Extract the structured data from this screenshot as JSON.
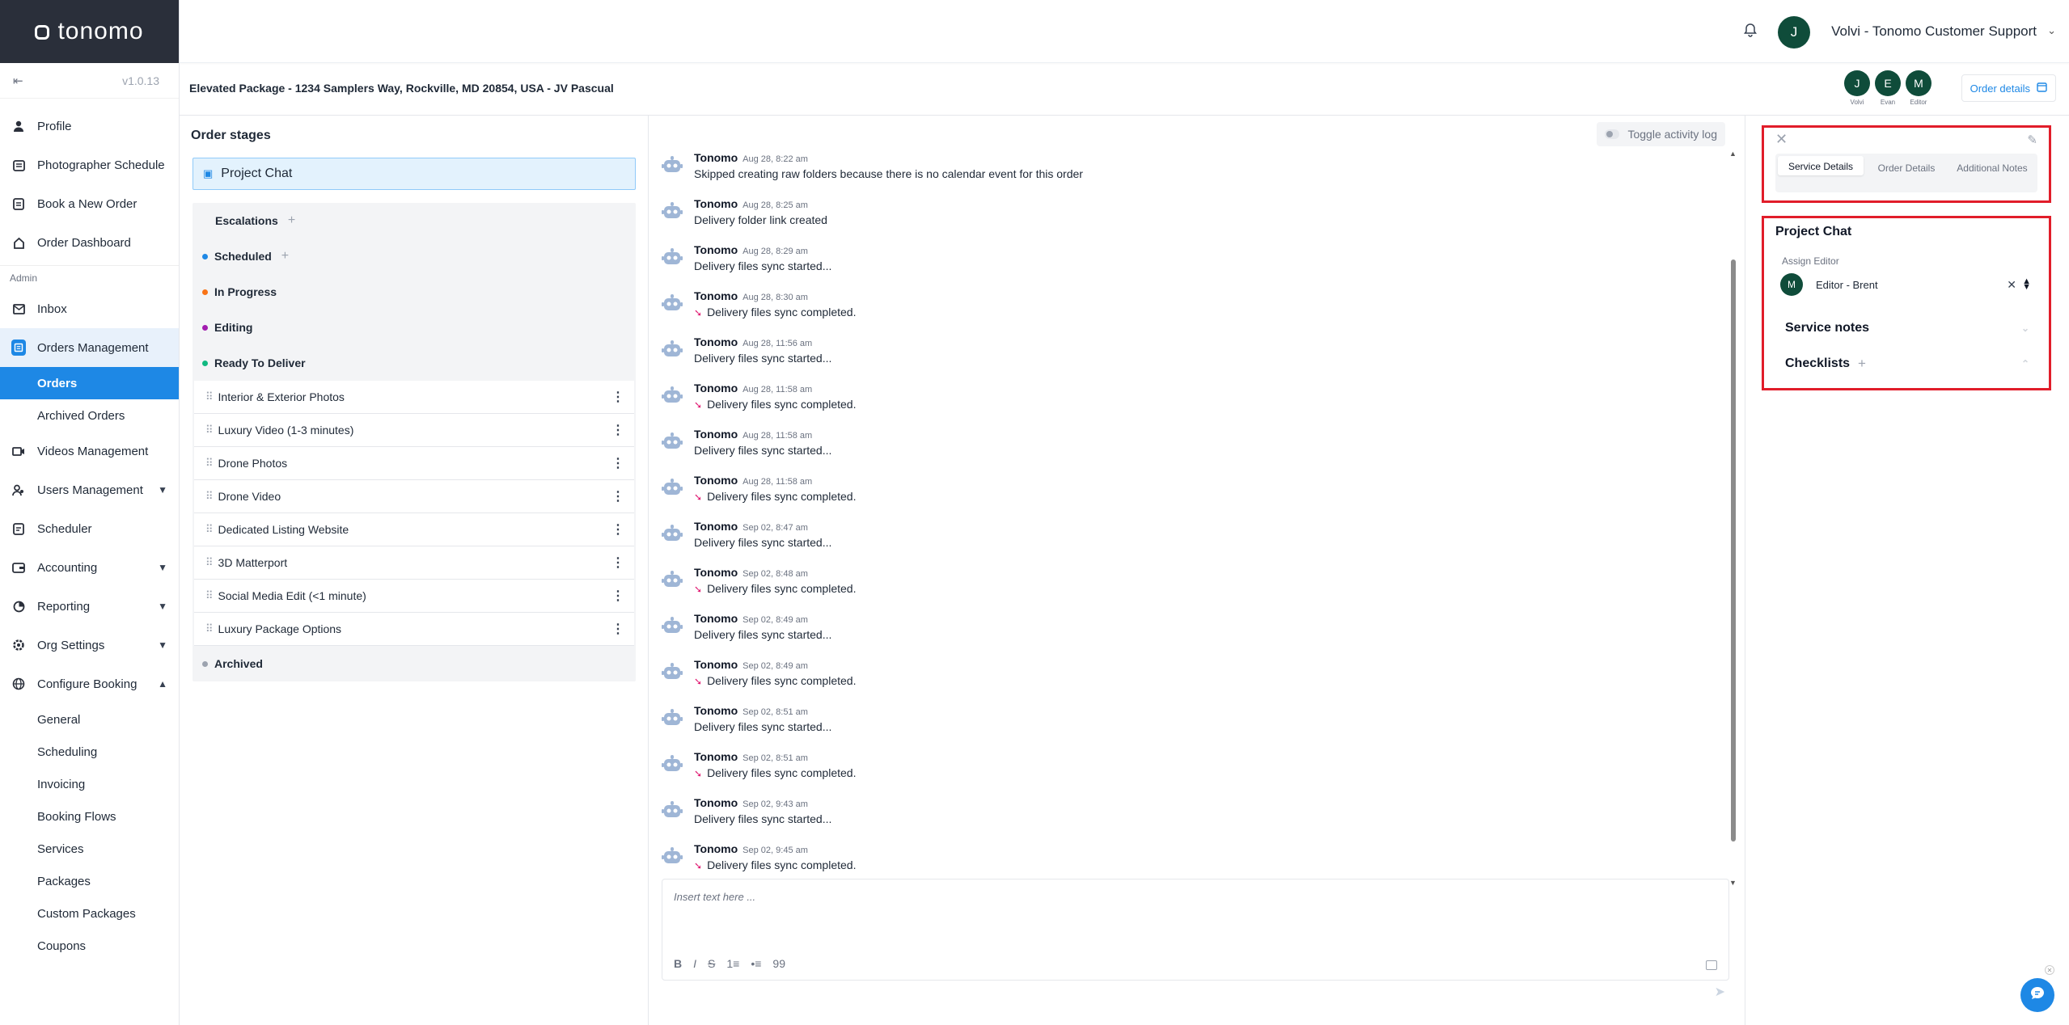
{
  "app": {
    "logo": "tonomo",
    "version": "v1.0.13"
  },
  "sidebar": {
    "items": [
      {
        "label": "Profile",
        "icon": "user-icon"
      },
      {
        "label": "Photographer Schedule",
        "icon": "calendar-icon"
      },
      {
        "label": "Book a New Order",
        "icon": "clipboard-icon"
      },
      {
        "label": "Order Dashboard",
        "icon": "home-icon"
      }
    ],
    "admin_label": "Admin",
    "admin_items": [
      {
        "label": "Inbox",
        "icon": "mail-icon"
      },
      {
        "label": "Orders Management",
        "icon": "orders-icon"
      },
      {
        "label": "Videos Management",
        "icon": "video-icon"
      },
      {
        "label": "Users Management",
        "icon": "users-icon"
      },
      {
        "label": "Scheduler",
        "icon": "scheduler-icon"
      },
      {
        "label": "Accounting",
        "icon": "wallet-icon"
      },
      {
        "label": "Reporting",
        "icon": "reporting-icon"
      },
      {
        "label": "Org Settings",
        "icon": "gear-icon"
      },
      {
        "label": "Configure Booking",
        "icon": "globe-icon"
      }
    ],
    "orders_sub": [
      "Orders",
      "Archived Orders"
    ],
    "configure_sub": [
      "General",
      "Scheduling",
      "Invoicing",
      "Booking Flows",
      "Services",
      "Packages",
      "Custom Packages",
      "Coupons"
    ]
  },
  "topbar": {
    "user_initial": "J",
    "user_name": "Volvi - Tonomo Customer Support"
  },
  "header": {
    "order_title": "Elevated Package - 1234 Samplers Way, Rockville, MD 20854, USA - JV Pascual",
    "avatars": [
      {
        "initial": "J",
        "label": "Volvi"
      },
      {
        "initial": "E",
        "label": "Evan"
      },
      {
        "initial": "M",
        "label": "Editor"
      }
    ],
    "order_details": "Order details"
  },
  "stages": {
    "title": "Order stages",
    "project_chat": "Project Chat",
    "escalations": "Escalations",
    "scheduled": "Scheduled",
    "in_progress": "In Progress",
    "editing": "Editing",
    "ready": "Ready To Deliver",
    "services": [
      "Interior & Exterior Photos",
      "Luxury Video (1-3 minutes)",
      "Drone Photos",
      "Drone Video",
      "Dedicated Listing Website",
      "3D Matterport",
      "Social Media Edit (<1 minute)",
      "Luxury Package Options"
    ],
    "archived": "Archived",
    "colors": {
      "scheduled": "#1e88e5",
      "in_progress": "#f97316",
      "editing": "#a21caf",
      "ready": "#10b981",
      "archived": "#9ca3af"
    }
  },
  "chat": {
    "toggle_label": "Toggle activity log",
    "messages": [
      {
        "who": "Tonomo",
        "when": "Aug 28, 8:22 am",
        "text": "Skipped creating raw folders because there is no calendar event for this order",
        "done": false
      },
      {
        "who": "Tonomo",
        "when": "Aug 28, 8:25 am",
        "text": "Delivery folder link created",
        "done": false
      },
      {
        "who": "Tonomo",
        "when": "Aug 28, 8:29 am",
        "text": "Delivery files sync started...",
        "done": false
      },
      {
        "who": "Tonomo",
        "when": "Aug 28, 8:30 am",
        "text": "Delivery files sync completed.",
        "done": true
      },
      {
        "who": "Tonomo",
        "when": "Aug 28, 11:56 am",
        "text": "Delivery files sync started...",
        "done": false
      },
      {
        "who": "Tonomo",
        "when": "Aug 28, 11:58 am",
        "text": "Delivery files sync completed.",
        "done": true
      },
      {
        "who": "Tonomo",
        "when": "Aug 28, 11:58 am",
        "text": "Delivery files sync started...",
        "done": false
      },
      {
        "who": "Tonomo",
        "when": "Aug 28, 11:58 am",
        "text": "Delivery files sync completed.",
        "done": true
      },
      {
        "who": "Tonomo",
        "when": "Sep 02, 8:47 am",
        "text": "Delivery files sync started...",
        "done": false
      },
      {
        "who": "Tonomo",
        "when": "Sep 02, 8:48 am",
        "text": "Delivery files sync completed.",
        "done": true
      },
      {
        "who": "Tonomo",
        "when": "Sep 02, 8:49 am",
        "text": "Delivery files sync started...",
        "done": false
      },
      {
        "who": "Tonomo",
        "when": "Sep 02, 8:49 am",
        "text": "Delivery files sync completed.",
        "done": true
      },
      {
        "who": "Tonomo",
        "when": "Sep 02, 8:51 am",
        "text": "Delivery files sync started...",
        "done": false
      },
      {
        "who": "Tonomo",
        "when": "Sep 02, 8:51 am",
        "text": "Delivery files sync completed.",
        "done": true
      },
      {
        "who": "Tonomo",
        "when": "Sep 02, 9:43 am",
        "text": "Delivery files sync started...",
        "done": false
      },
      {
        "who": "Tonomo",
        "when": "Sep 02, 9:45 am",
        "text": "Delivery files sync completed.",
        "done": true
      }
    ],
    "input_placeholder": "Insert text here ...",
    "toolbar": [
      "B",
      "I",
      "S",
      "1≡",
      "•≡",
      "99"
    ]
  },
  "right_panel": {
    "tabs": [
      "Service Details",
      "Order Details",
      "Additional Notes"
    ],
    "project_chat": "Project Chat",
    "assign_label": "Assign Editor",
    "assign_initial": "M",
    "assign_value": "Editor - Brent",
    "service_notes": "Service notes",
    "checklists": "Checklists"
  }
}
